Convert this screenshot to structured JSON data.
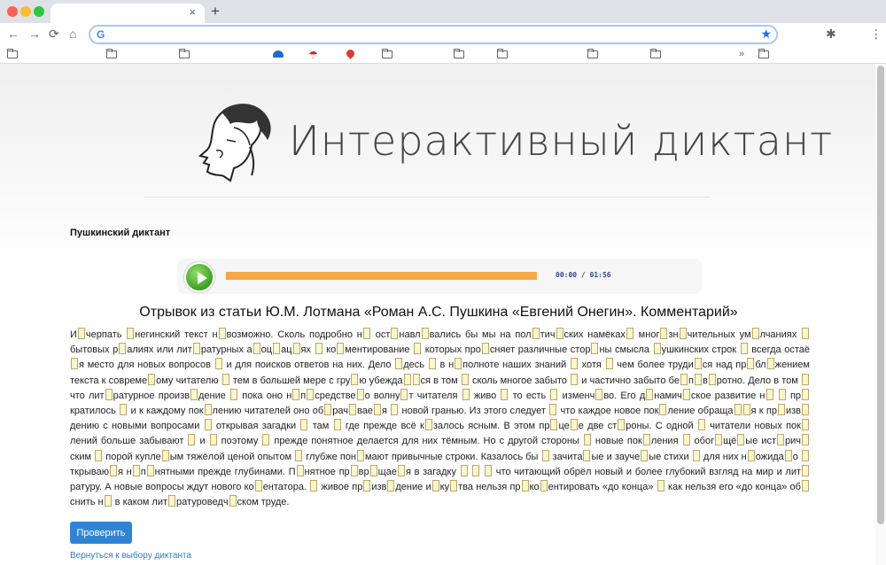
{
  "browser": {
    "tab_close": "×",
    "new_tab": "+",
    "url": "",
    "back": "←",
    "forward": "→",
    "reload": "⟳",
    "home": "⌂",
    "star": "★",
    "extensions": "✱",
    "menu": "⋮",
    "g": "G",
    "bookmarks_more": "»"
  },
  "page": {
    "logo_title": "Интерактивный диктант",
    "dictation_name": "Пушкинский диктант",
    "audio": {
      "time": "00:00 / 01:56",
      "progress": 0.0
    },
    "heading": "Отрывок из статьи Ю.М. Лотмана «Роман А.С. Пушкина «Евгений Онегин». Комментарий»",
    "text": "И_черпать _негинский текст н_возможно. Сколь подробно н_ ост_навл_вались бы мы на пол_тич_ских намёках_ мног_зн_чительных ум_лчаниях _ бытовых р_алиях или лит_ратурных а_оц_ац_ях _ ко_ментирование _ которых про_сняет различные стор_ны смысла _ушкинских строк _ всегда остаё_я место для новых вопросов _ и для поисков ответов на них. Дело _десь _ в н_полноте наших знаний _ хотя _ чем более труди_ся над пр_бл_жением текста к совреме_ому читателю _ тем в большей мере с гру_ю убежда__ся в том _ сколь многое забыто _ и частично забыто бе_п_в_ротно. Дело в том _ что лит_ратурное произв_дение _ пока оно н_п_средстве_о волну_т читателя _ живо _ то есть _ изменч_во. Его д_намич_ское развитие н_ _ пр_кратилось _ и к каждому пок_лению читателей оно об_рач_вае_я _ новой гранью. Из этого следует _ что каждое новое пок_ление обраща__я к пр_изв_дению с новыми вопросами _ открывая загадки _ там _ где прежде всё к_залось ясным. В этом пр_це_е две ст_роны. С одной _ читатели новых пок_лений больше забывают _ и _ поэтому _ прежде понятное делается для них тёмным. Но с другой стороны _ новые пок_ления _ обог_щё_ые ист_рич_ским _ порой купле_ым тяжёлой ценой опытом _ глубже пон_мают привычные строки. Казалось бы _ зачита_ые и зауче_ые стихи _ для них н_ожида_о _ткрываю_я н_п_нятными прежде глубинами. П_нятное пр_вр_щае_я в загадку _ _ _ что читающий обрёл новый и более глубокий взгляд на мир и лит_ратуру. А новые вопросы ждут нового ко_ентатора. _ живое пр_изв_дение и_ку_тва нельзя пр_ко_ентировать «до конца» _ как нельзя его «до конца» об_снить н_ в каком лит_ратуроведч_ском труде.",
    "check_button": "Проверить",
    "back_link": "Вернуться к выбору диктанта"
  }
}
